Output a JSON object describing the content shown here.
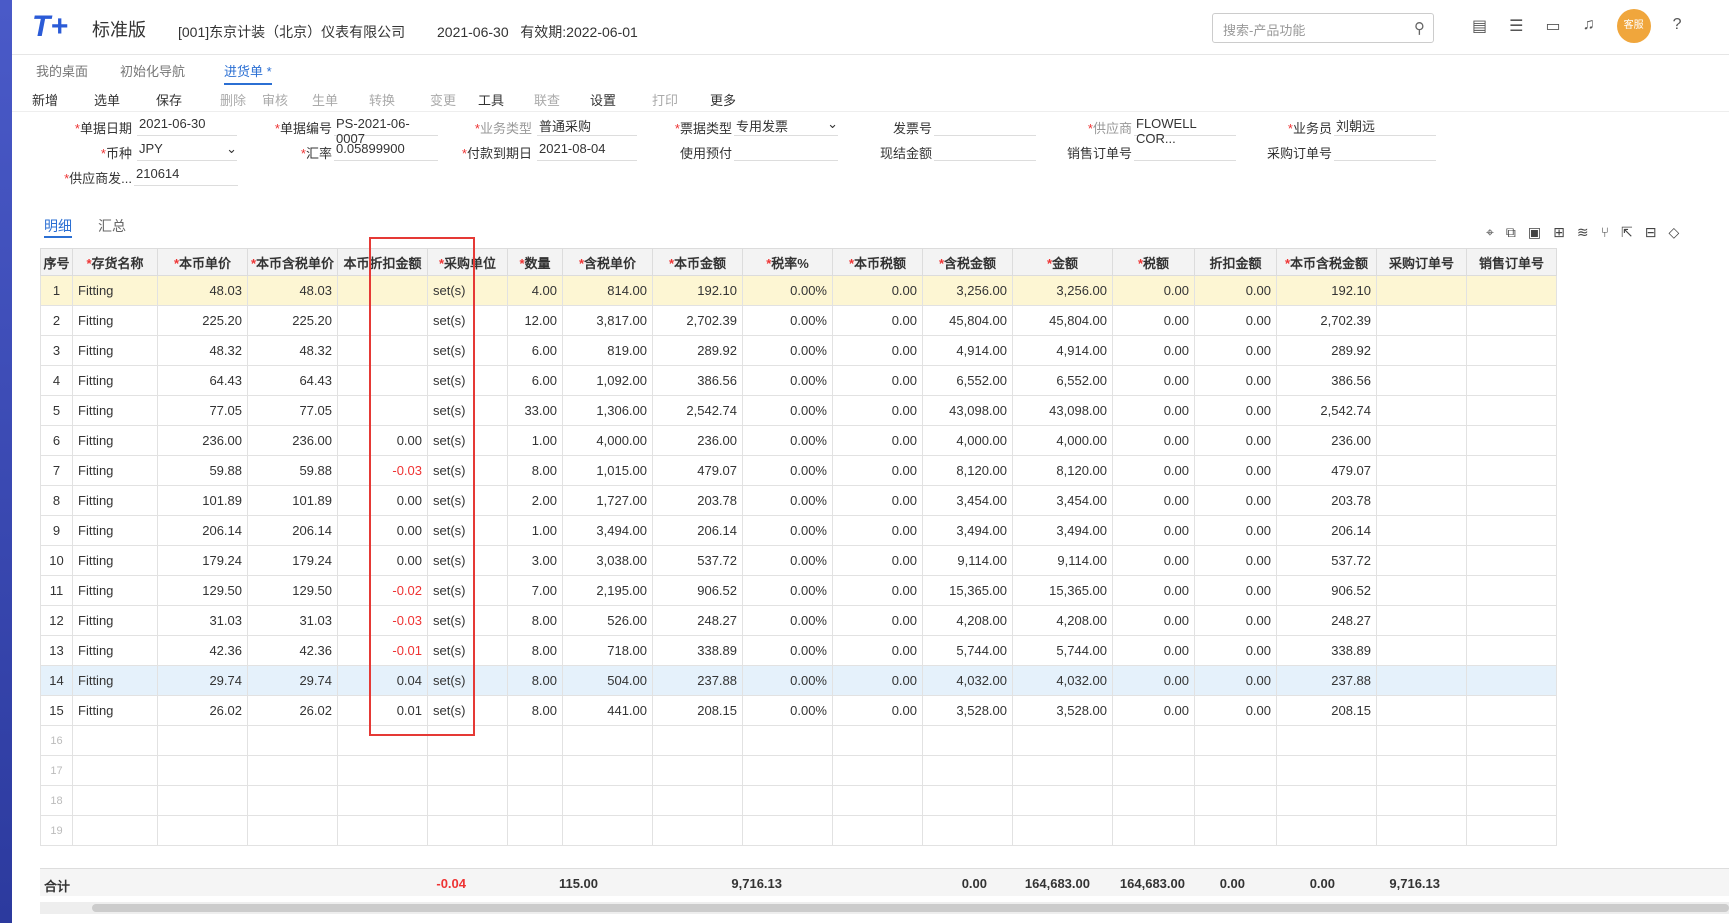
{
  "app": {
    "edition": "标准版",
    "company": "[001]东京计装（北京）仪表有限公司",
    "date": "2021-06-30",
    "expiry": "有效期:2022-06-01",
    "search_placeholder": "搜索-产品功能",
    "service": "客服"
  },
  "tabs": [
    {
      "label": "我的桌面"
    },
    {
      "label": "初始化导航"
    },
    {
      "label": "进货单 *",
      "active": true
    }
  ],
  "toolbar": [
    "新增",
    "选单",
    "保存",
    "删除",
    "审核",
    "生单",
    "转换",
    "变更",
    "工具",
    "联查",
    "设置",
    "打印",
    "更多"
  ],
  "form": {
    "date_label": "单据日期",
    "date": "2021-06-30",
    "no_label": "单据编号",
    "no": "PS-2021-06-0007",
    "biz_label": "业务类型",
    "biz": "普通采购",
    "bill_label": "票据类型",
    "bill": "专用发票",
    "invoice_label": "发票号",
    "invoice": "",
    "vendor_label": "供应商",
    "vendor": "FLOWELL COR...",
    "clerk_label": "业务员",
    "clerk": "刘朝远",
    "cur_label": "币种",
    "cur": "JPY",
    "rate_label": "汇率",
    "rate": "0.05899900",
    "due_label": "付款到期日",
    "due": "2021-08-04",
    "prepay_label": "使用预付",
    "cash_label": "现结金额",
    "so_label": "销售订单号",
    "po_label": "采购订单号",
    "vship_label": "供应商发...",
    "vship": "210614"
  },
  "subtabs": [
    "明细",
    "汇总"
  ],
  "columns": [
    "序号",
    "存货名称",
    "本币单价",
    "本币含税单价",
    "本币折扣金额",
    "采购单位",
    "数量",
    "含税单价",
    "本币金额",
    "税率%",
    "本币税额",
    "含税金额",
    "金额",
    "税额",
    "折扣金额",
    "本币含税金额",
    "采购订单号",
    "销售订单号"
  ],
  "rows": [
    [
      "1",
      "Fitting",
      "48.03",
      "48.03",
      "",
      "set(s)",
      "4.00",
      "814.00",
      "192.10",
      "0.00%",
      "0.00",
      "3,256.00",
      "3,256.00",
      "0.00",
      "0.00",
      "192.10"
    ],
    [
      "2",
      "Fitting",
      "225.20",
      "225.20",
      "",
      "set(s)",
      "12.00",
      "3,817.00",
      "2,702.39",
      "0.00%",
      "0.00",
      "45,804.00",
      "45,804.00",
      "0.00",
      "0.00",
      "2,702.39"
    ],
    [
      "3",
      "Fitting",
      "48.32",
      "48.32",
      "",
      "set(s)",
      "6.00",
      "819.00",
      "289.92",
      "0.00%",
      "0.00",
      "4,914.00",
      "4,914.00",
      "0.00",
      "0.00",
      "289.92"
    ],
    [
      "4",
      "Fitting",
      "64.43",
      "64.43",
      "",
      "set(s)",
      "6.00",
      "1,092.00",
      "386.56",
      "0.00%",
      "0.00",
      "6,552.00",
      "6,552.00",
      "0.00",
      "0.00",
      "386.56"
    ],
    [
      "5",
      "Fitting",
      "77.05",
      "77.05",
      "",
      "set(s)",
      "33.00",
      "1,306.00",
      "2,542.74",
      "0.00%",
      "0.00",
      "43,098.00",
      "43,098.00",
      "0.00",
      "0.00",
      "2,542.74"
    ],
    [
      "6",
      "Fitting",
      "236.00",
      "236.00",
      "0.00",
      "set(s)",
      "1.00",
      "4,000.00",
      "236.00",
      "0.00%",
      "0.00",
      "4,000.00",
      "4,000.00",
      "0.00",
      "0.00",
      "236.00"
    ],
    [
      "7",
      "Fitting",
      "59.88",
      "59.88",
      "-0.03",
      "set(s)",
      "8.00",
      "1,015.00",
      "479.07",
      "0.00%",
      "0.00",
      "8,120.00",
      "8,120.00",
      "0.00",
      "0.00",
      "479.07"
    ],
    [
      "8",
      "Fitting",
      "101.89",
      "101.89",
      "0.00",
      "set(s)",
      "2.00",
      "1,727.00",
      "203.78",
      "0.00%",
      "0.00",
      "3,454.00",
      "3,454.00",
      "0.00",
      "0.00",
      "203.78"
    ],
    [
      "9",
      "Fitting",
      "206.14",
      "206.14",
      "0.00",
      "set(s)",
      "1.00",
      "3,494.00",
      "206.14",
      "0.00%",
      "0.00",
      "3,494.00",
      "3,494.00",
      "0.00",
      "0.00",
      "206.14"
    ],
    [
      "10",
      "Fitting",
      "179.24",
      "179.24",
      "0.00",
      "set(s)",
      "3.00",
      "3,038.00",
      "537.72",
      "0.00%",
      "0.00",
      "9,114.00",
      "9,114.00",
      "0.00",
      "0.00",
      "537.72"
    ],
    [
      "11",
      "Fitting",
      "129.50",
      "129.50",
      "-0.02",
      "set(s)",
      "7.00",
      "2,195.00",
      "906.52",
      "0.00%",
      "0.00",
      "15,365.00",
      "15,365.00",
      "0.00",
      "0.00",
      "906.52"
    ],
    [
      "12",
      "Fitting",
      "31.03",
      "31.03",
      "-0.03",
      "set(s)",
      "8.00",
      "526.00",
      "248.27",
      "0.00%",
      "0.00",
      "4,208.00",
      "4,208.00",
      "0.00",
      "0.00",
      "248.27"
    ],
    [
      "13",
      "Fitting",
      "42.36",
      "42.36",
      "-0.01",
      "set(s)",
      "8.00",
      "718.00",
      "338.89",
      "0.00%",
      "0.00",
      "5,744.00",
      "5,744.00",
      "0.00",
      "0.00",
      "338.89"
    ],
    [
      "14",
      "Fitting",
      "29.74",
      "29.74",
      "0.04",
      "set(s)",
      "8.00",
      "504.00",
      "237.88",
      "0.00%",
      "0.00",
      "4,032.00",
      "4,032.00",
      "0.00",
      "0.00",
      "237.88"
    ],
    [
      "15",
      "Fitting",
      "26.02",
      "26.02",
      "0.01",
      "set(s)",
      "8.00",
      "441.00",
      "208.15",
      "0.00%",
      "0.00",
      "3,528.00",
      "3,528.00",
      "0.00",
      "0.00",
      "208.15"
    ]
  ],
  "empty_rows": [
    "16",
    "17",
    "18",
    "19"
  ],
  "totals": {
    "label": "合计",
    "disc": "-0.04",
    "qty": "115.00",
    "amt": "9,716.13",
    "tax": "0.00",
    "taxamt": "164,683.00",
    "amount": "164,683.00",
    "t": "0.00",
    "d": "0.00",
    "lctax": "9,716.13"
  }
}
